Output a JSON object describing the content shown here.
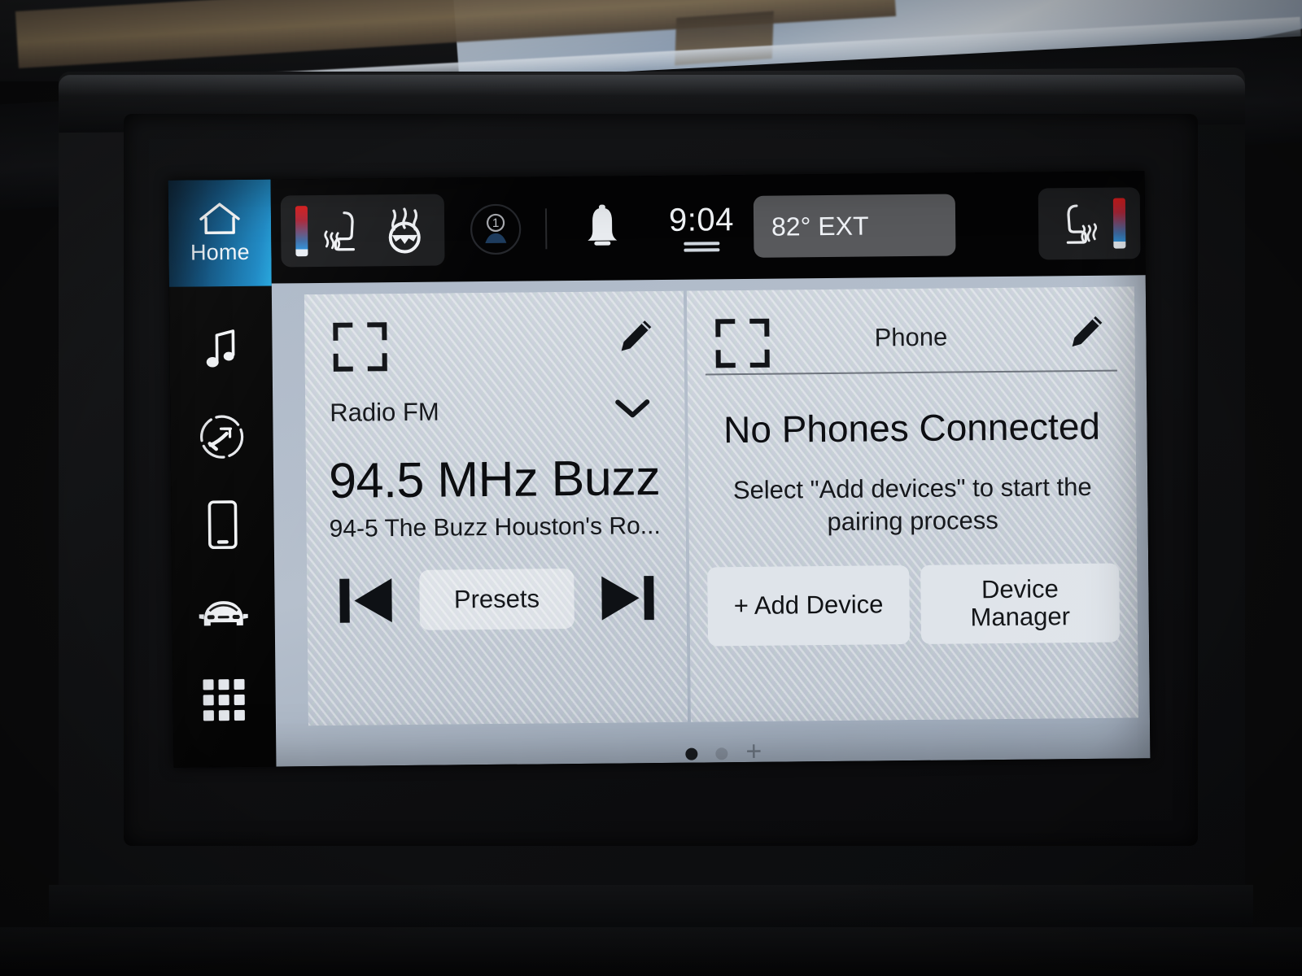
{
  "sidebar": {
    "home": {
      "label": "Home",
      "icon": "home-icon"
    },
    "items": [
      {
        "name": "media",
        "icon": "music-note-icon"
      },
      {
        "name": "climate",
        "icon": "climate-airflow-icon"
      },
      {
        "name": "phone",
        "icon": "phone-device-icon"
      },
      {
        "name": "vehicle",
        "icon": "vehicle-front-icon"
      },
      {
        "name": "apps",
        "icon": "apps-grid-icon"
      }
    ]
  },
  "statusbar": {
    "driver_temp_bar": "temperature-gradient-bar",
    "heated_seat_driver": "heated-seat-icon",
    "heated_steering_wheel": "heated-steering-wheel-icon",
    "driver_profile": "driver-profile-icon",
    "notifications": "bell-icon",
    "time": "9:04",
    "exterior_temp": "82° EXT",
    "heated_seat_passenger": "heated-seat-icon",
    "passenger_temp_bar": "temperature-gradient-bar"
  },
  "radio_card": {
    "expand_icon": "expand-brackets-icon",
    "edit_icon": "pencil-icon",
    "source": "Radio FM",
    "source_chevron": "chevron-down-icon",
    "station": "94.5 MHz Buzz",
    "station_info": "94-5 The Buzz Houston's Ro...",
    "prev_icon": "skip-previous-icon",
    "presets_label": "Presets",
    "next_icon": "skip-next-icon"
  },
  "phone_card": {
    "expand_icon": "expand-brackets-icon",
    "title": "Phone",
    "edit_icon": "pencil-icon",
    "status": "No Phones Connected",
    "hint": "Select \"Add devices\" to start the pairing process",
    "add_device_label": "+ Add Device",
    "device_manager_label": "Device Manager"
  },
  "pager": {
    "plus": "+",
    "pages": 2,
    "active_page": 1
  },
  "colors": {
    "home_accent": "#1a88c4",
    "screen_bg": "#aeb9c8",
    "card_bg": "#cbd2db",
    "temp_hot": "#e01d1d",
    "temp_cold": "#2f8fd6"
  }
}
